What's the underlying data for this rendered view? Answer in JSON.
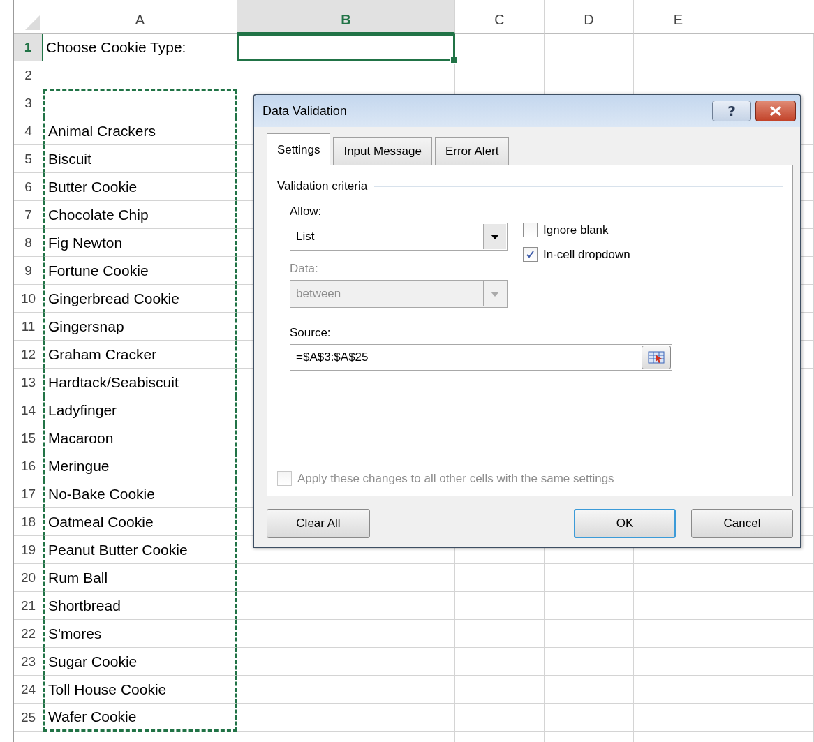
{
  "columns": [
    {
      "label": "A",
      "selected": false
    },
    {
      "label": "B",
      "selected": true
    },
    {
      "label": "C",
      "selected": false
    },
    {
      "label": "D",
      "selected": false
    },
    {
      "label": "E",
      "selected": false
    }
  ],
  "rows": [
    {
      "number": "1",
      "selected": true,
      "copied": false,
      "a": "Choose Cookie Type:"
    },
    {
      "number": "2",
      "selected": false,
      "copied": false
    },
    {
      "number": "3",
      "selected": false,
      "copied": true
    },
    {
      "number": "4",
      "selected": false,
      "copied": true,
      "a": "Animal Crackers"
    },
    {
      "number": "5",
      "selected": false,
      "copied": true,
      "a": "Biscuit"
    },
    {
      "number": "6",
      "selected": false,
      "copied": true,
      "a": "Butter Cookie"
    },
    {
      "number": "7",
      "selected": false,
      "copied": true,
      "a": "Chocolate Chip"
    },
    {
      "number": "8",
      "selected": false,
      "copied": true,
      "a": "Fig Newton"
    },
    {
      "number": "9",
      "selected": false,
      "copied": true,
      "a": "Fortune Cookie"
    },
    {
      "number": "10",
      "selected": false,
      "copied": true,
      "a": "Gingerbread Cookie"
    },
    {
      "number": "11",
      "selected": false,
      "copied": true,
      "a": "Gingersnap"
    },
    {
      "number": "12",
      "selected": false,
      "copied": true,
      "a": "Graham Cracker"
    },
    {
      "number": "13",
      "selected": false,
      "copied": true,
      "a": "Hardtack/Seabiscuit"
    },
    {
      "number": "14",
      "selected": false,
      "copied": true,
      "a": "Ladyfinger"
    },
    {
      "number": "15",
      "selected": false,
      "copied": true,
      "a": "Macaroon"
    },
    {
      "number": "16",
      "selected": false,
      "copied": true,
      "a": "Meringue"
    },
    {
      "number": "17",
      "selected": false,
      "copied": true,
      "a": "No-Bake Cookie"
    },
    {
      "number": "18",
      "selected": false,
      "copied": true,
      "a": "Oatmeal Cookie"
    },
    {
      "number": "19",
      "selected": false,
      "copied": true,
      "a": "Peanut Butter Cookie"
    },
    {
      "number": "20",
      "selected": false,
      "copied": true,
      "a": "Rum Ball"
    },
    {
      "number": "21",
      "selected": false,
      "copied": true,
      "a": "Shortbread"
    },
    {
      "number": "22",
      "selected": false,
      "copied": true,
      "a": "S'mores"
    },
    {
      "number": "23",
      "selected": false,
      "copied": true,
      "a": "Sugar Cookie"
    },
    {
      "number": "24",
      "selected": false,
      "copied": true,
      "a": "Toll House Cookie"
    },
    {
      "number": "25",
      "selected": false,
      "copied": true,
      "a": "Wafer Cookie"
    }
  ],
  "dialog": {
    "title": "Data Validation",
    "help_label": "?",
    "tabs": [
      {
        "label": "Settings",
        "selected": true
      },
      {
        "label": "Input Message",
        "selected": false
      },
      {
        "label": "Error Alert",
        "selected": false
      }
    ],
    "section": "Validation criteria",
    "allow": {
      "label": "Allow:",
      "value": "List",
      "disabled": false
    },
    "data": {
      "label": "Data:",
      "value": "between",
      "disabled": true
    },
    "options": [
      {
        "label": "Ignore blank",
        "checked": false
      },
      {
        "label": "In-cell dropdown",
        "checked": true
      }
    ],
    "source": {
      "label": "Source:",
      "value": "=$A$3:$A$25"
    },
    "apply_all": {
      "label": "Apply these changes to all other cells with the same settings",
      "checked": false,
      "disabled": true
    },
    "buttons": [
      {
        "label": "Clear All",
        "kind": "secondary"
      },
      {
        "label": "OK",
        "kind": "default"
      },
      {
        "label": "Cancel",
        "kind": "normal"
      }
    ]
  }
}
